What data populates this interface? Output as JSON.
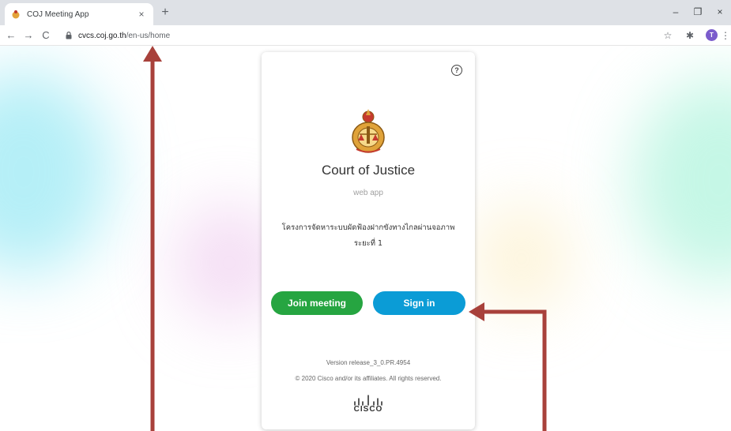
{
  "browser": {
    "tab_title": "COJ Meeting App",
    "tab_close": "×",
    "new_tab": "+",
    "minimize": "–",
    "restore": "❐",
    "close": "×",
    "back": "←",
    "forward": "→",
    "reload": "C",
    "url_domain": "cvcs.coj.go.th",
    "url_path": "/en-us/home",
    "bookmark_icon": "☆",
    "extensions_icon": "✱",
    "profile_initial": "T",
    "menu_icon": "⋮"
  },
  "card": {
    "help": "?",
    "title": "Court of Justice",
    "subtitle": "web app",
    "project_line1": "โครงการจัดหาระบบผัดฟ้องฝากขังทางไกลผ่านจอภาพ",
    "project_line2": "ระยะที่ 1",
    "join_label": "Join meeting",
    "signin_label": "Sign in",
    "version": "Version release_3_0.PR.4954",
    "copyright": "© 2020 Cisco and/or its affiliates. All rights reserved.",
    "cisco_wordmark": "CISCO"
  },
  "colors": {
    "join_button": "#26a541",
    "signin_button": "#0b9cd6",
    "arrow": "#a8413b",
    "profile": "#7b5ccc"
  }
}
